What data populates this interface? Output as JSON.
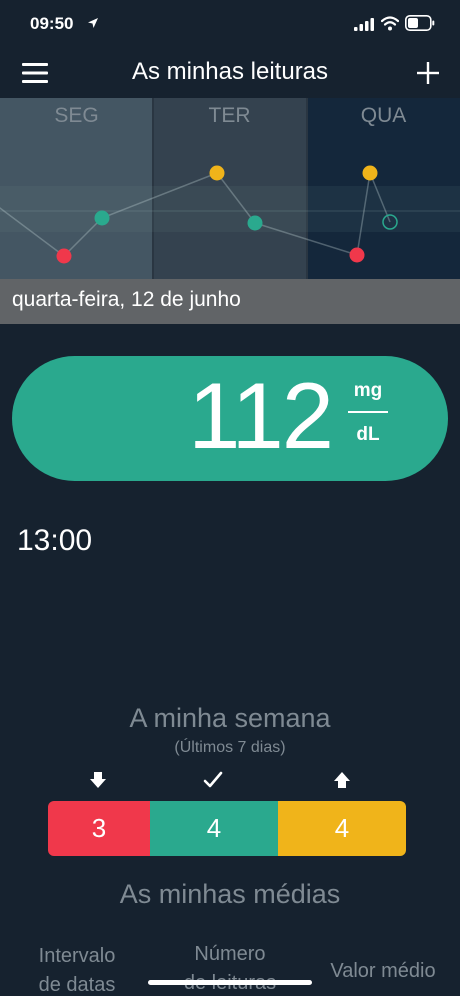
{
  "status_bar": {
    "time": "09:50"
  },
  "nav": {
    "title": "As minhas leituras",
    "menu_icon": "menu-icon",
    "add_icon": "plus-icon"
  },
  "chart_data": {
    "type": "scatter",
    "categories": [
      "SEG",
      "TER",
      "QUA"
    ],
    "colors": {
      "low": "#f0384b",
      "in_range": "#2aa98e",
      "high": "#f0b41a"
    },
    "series": [
      {
        "values": [
          {
            "day": "SEG",
            "level": "low"
          },
          {
            "day": "SEG",
            "level": "in_range"
          },
          {
            "day": "TER",
            "level": "high"
          },
          {
            "day": "TER",
            "level": "in_range"
          },
          {
            "day": "QUA",
            "level": "low"
          },
          {
            "day": "QUA",
            "level": "high"
          },
          {
            "day": "QUA",
            "level": "in_range",
            "selected": true
          }
        ]
      }
    ]
  },
  "date_bar": {
    "text": "quarta-feira, 12 de junho"
  },
  "reading": {
    "value": "112",
    "unit_top": "mg",
    "unit_bottom": "dL",
    "time": "13:00",
    "color": "#2aa98e"
  },
  "week": {
    "title": "A minha semana",
    "subtitle": "(Últimos 7 dias)",
    "icons": [
      "arrow-down-icon",
      "check-icon",
      "arrow-up-icon"
    ],
    "low": "3",
    "in_range": "4",
    "high": "4"
  },
  "averages": {
    "title": "As minhas médias",
    "col_dates_1": "Intervalo",
    "col_dates_2": "de datas",
    "col_count_1": "Número",
    "col_count_2": "de leituras",
    "col_avg": "Valor médio"
  },
  "colors": {
    "background": "#16222f",
    "green": "#2aa98e",
    "red": "#f0384b",
    "yellow": "#f0b41a",
    "muted_text": "#7f8a93"
  }
}
